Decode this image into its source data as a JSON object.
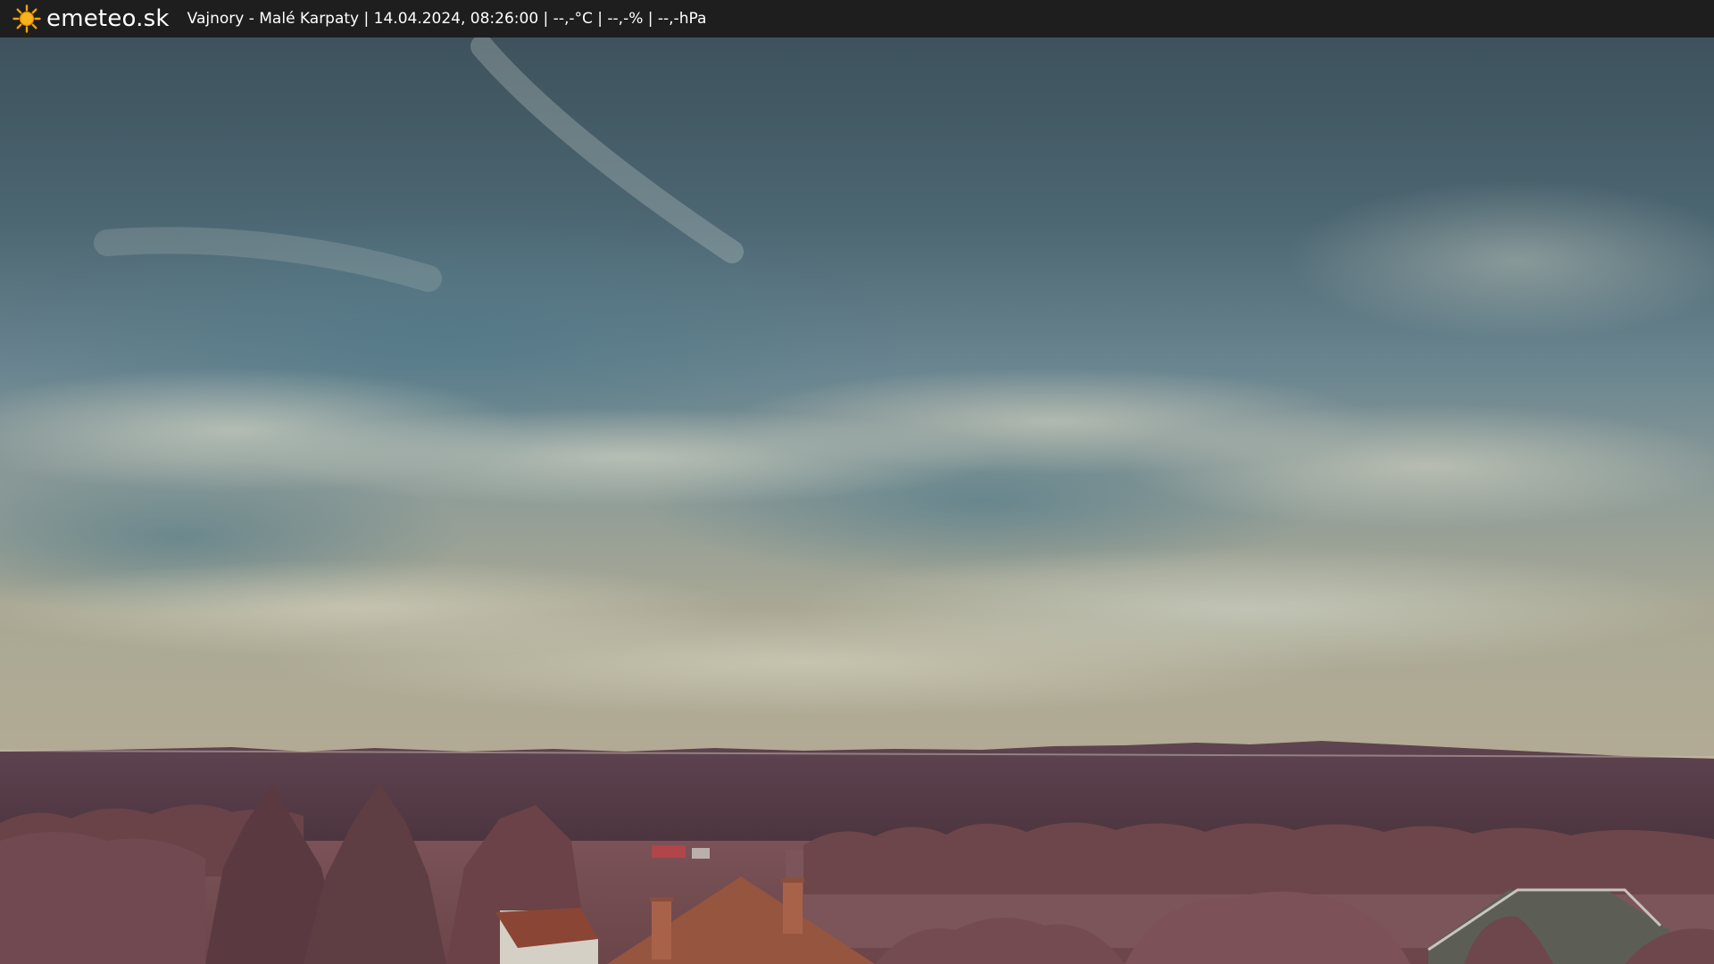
{
  "brand": {
    "name": "emeteo.sk",
    "icon": "sun-icon"
  },
  "caption": {
    "text": "Vajnory - Malé Karpaty | 14.04.2024, 08:26:00 | --,-°C | --,-% | --,-hPa"
  },
  "colors": {
    "bar_background": "#1e1e1e",
    "sky_top": "#3e5560",
    "sky_mid": "#6d8894",
    "sky_horizon": "#a8a796",
    "hills": "#5a3f4a",
    "foliage": "#7a4f55",
    "field": "#6e4a4f",
    "roof": "#8a4a36"
  }
}
